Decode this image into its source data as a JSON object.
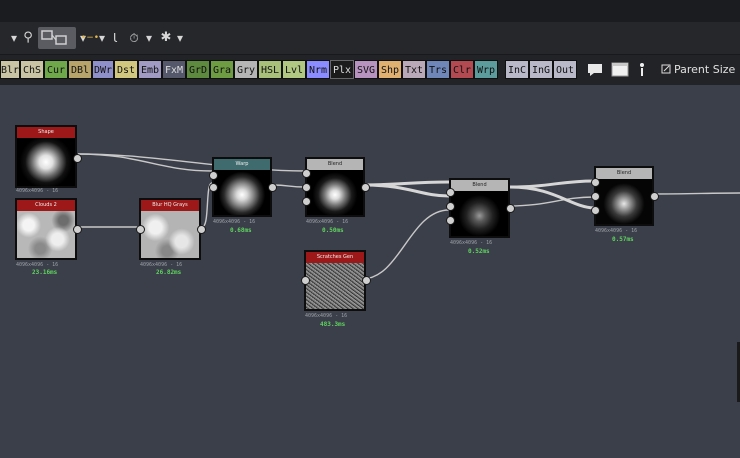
{
  "toolbar": {
    "icons": [
      "chevron-down-icon",
      "zoom-icon",
      "frame-nodes-icon",
      "chevron-down-icon",
      "link-icon",
      "chevron-down-icon",
      "return-icon",
      "timer-icon",
      "chevron-down-icon",
      "settings-icon",
      "chevron-down-icon"
    ],
    "glyphs": {
      "chevron": "▾",
      "zoom": "⚲",
      "link": "•−•",
      "ret": "Ɩ",
      "timer": "⏱",
      "gear": "✱"
    }
  },
  "filter_buttons": [
    {
      "label": "Blr",
      "color": "#c9c5a4"
    },
    {
      "label": "ChS",
      "color": "#c9c5a4"
    },
    {
      "label": "Cur",
      "color": "#6fa84a"
    },
    {
      "label": "DBl",
      "color": "#b7a46a"
    },
    {
      "label": "DWr",
      "color": "#8f8fc9"
    },
    {
      "label": "Dst",
      "color": "#d1c77e"
    },
    {
      "label": "Emb",
      "color": "#a19ac2"
    },
    {
      "label": "FxM",
      "color": "#54586a"
    },
    {
      "label": "GrD",
      "color": "#5d8a3e"
    },
    {
      "label": "Gra",
      "color": "#6d9c43"
    },
    {
      "label": "Gry",
      "color": "#b5b5b5"
    },
    {
      "label": "HSL",
      "color": "#a8c07a"
    },
    {
      "label": "Lvl",
      "color": "#b0c882"
    },
    {
      "label": "Nrm",
      "color": "#8a8cff"
    },
    {
      "label": "Plx",
      "color": "#1b1b1b"
    },
    {
      "label": "SVG",
      "color": "#b893c0"
    },
    {
      "label": "Shp",
      "color": "#e0b070"
    },
    {
      "label": "Txt",
      "color": "#b9a8b8"
    },
    {
      "label": "Trs",
      "color": "#6f86b8"
    },
    {
      "label": "Clr",
      "color": "#b34a52"
    },
    {
      "label": "Wrp",
      "color": "#5c9c9c"
    },
    {
      "label": "InC",
      "color": "#b8b8c8"
    },
    {
      "label": "InG",
      "color": "#b8b8c8"
    },
    {
      "label": "Out",
      "color": "#b8b8c8"
    }
  ],
  "right_tools": {
    "comment_icon": "comment-icon",
    "frame_icon": "frame-icon",
    "pin_icon": "pin-icon",
    "parent_size_label": "Parent Size"
  },
  "nodes": [
    {
      "id": "shape",
      "title": "Shape",
      "header_color": "#9d1919",
      "info": "4096x4096 - 16",
      "time": ""
    },
    {
      "id": "clouds",
      "title": "Clouds 2",
      "header_color": "#9d1919",
      "info": "4096x4096 - 16",
      "time": "23.16ms"
    },
    {
      "id": "blur",
      "title": "Blur HQ Grays",
      "header_color": "#9d1919",
      "info": "4096x4096 - 16",
      "time": "26.82ms"
    },
    {
      "id": "warp",
      "title": "Warp",
      "header_color": "#3f6b6e",
      "info": "4096x4096 - 16",
      "time": "0.68ms"
    },
    {
      "id": "blend1",
      "title": "Blend",
      "header_color": "#b5b5b5",
      "info": "4096x4096 - 16",
      "time": "0.50ms"
    },
    {
      "id": "scratches",
      "title": "Scratches Gen",
      "header_color": "#9d1919",
      "info": "4096x4096 - 16",
      "time": "483.3ms"
    },
    {
      "id": "blend2",
      "title": "Blend",
      "header_color": "#b5b5b5",
      "info": "4096x4096 - 16",
      "time": "0.52ms"
    },
    {
      "id": "blend3",
      "title": "Blend",
      "header_color": "#b5b5b5",
      "info": "4096x4096 - 16",
      "time": "0.57ms"
    }
  ]
}
